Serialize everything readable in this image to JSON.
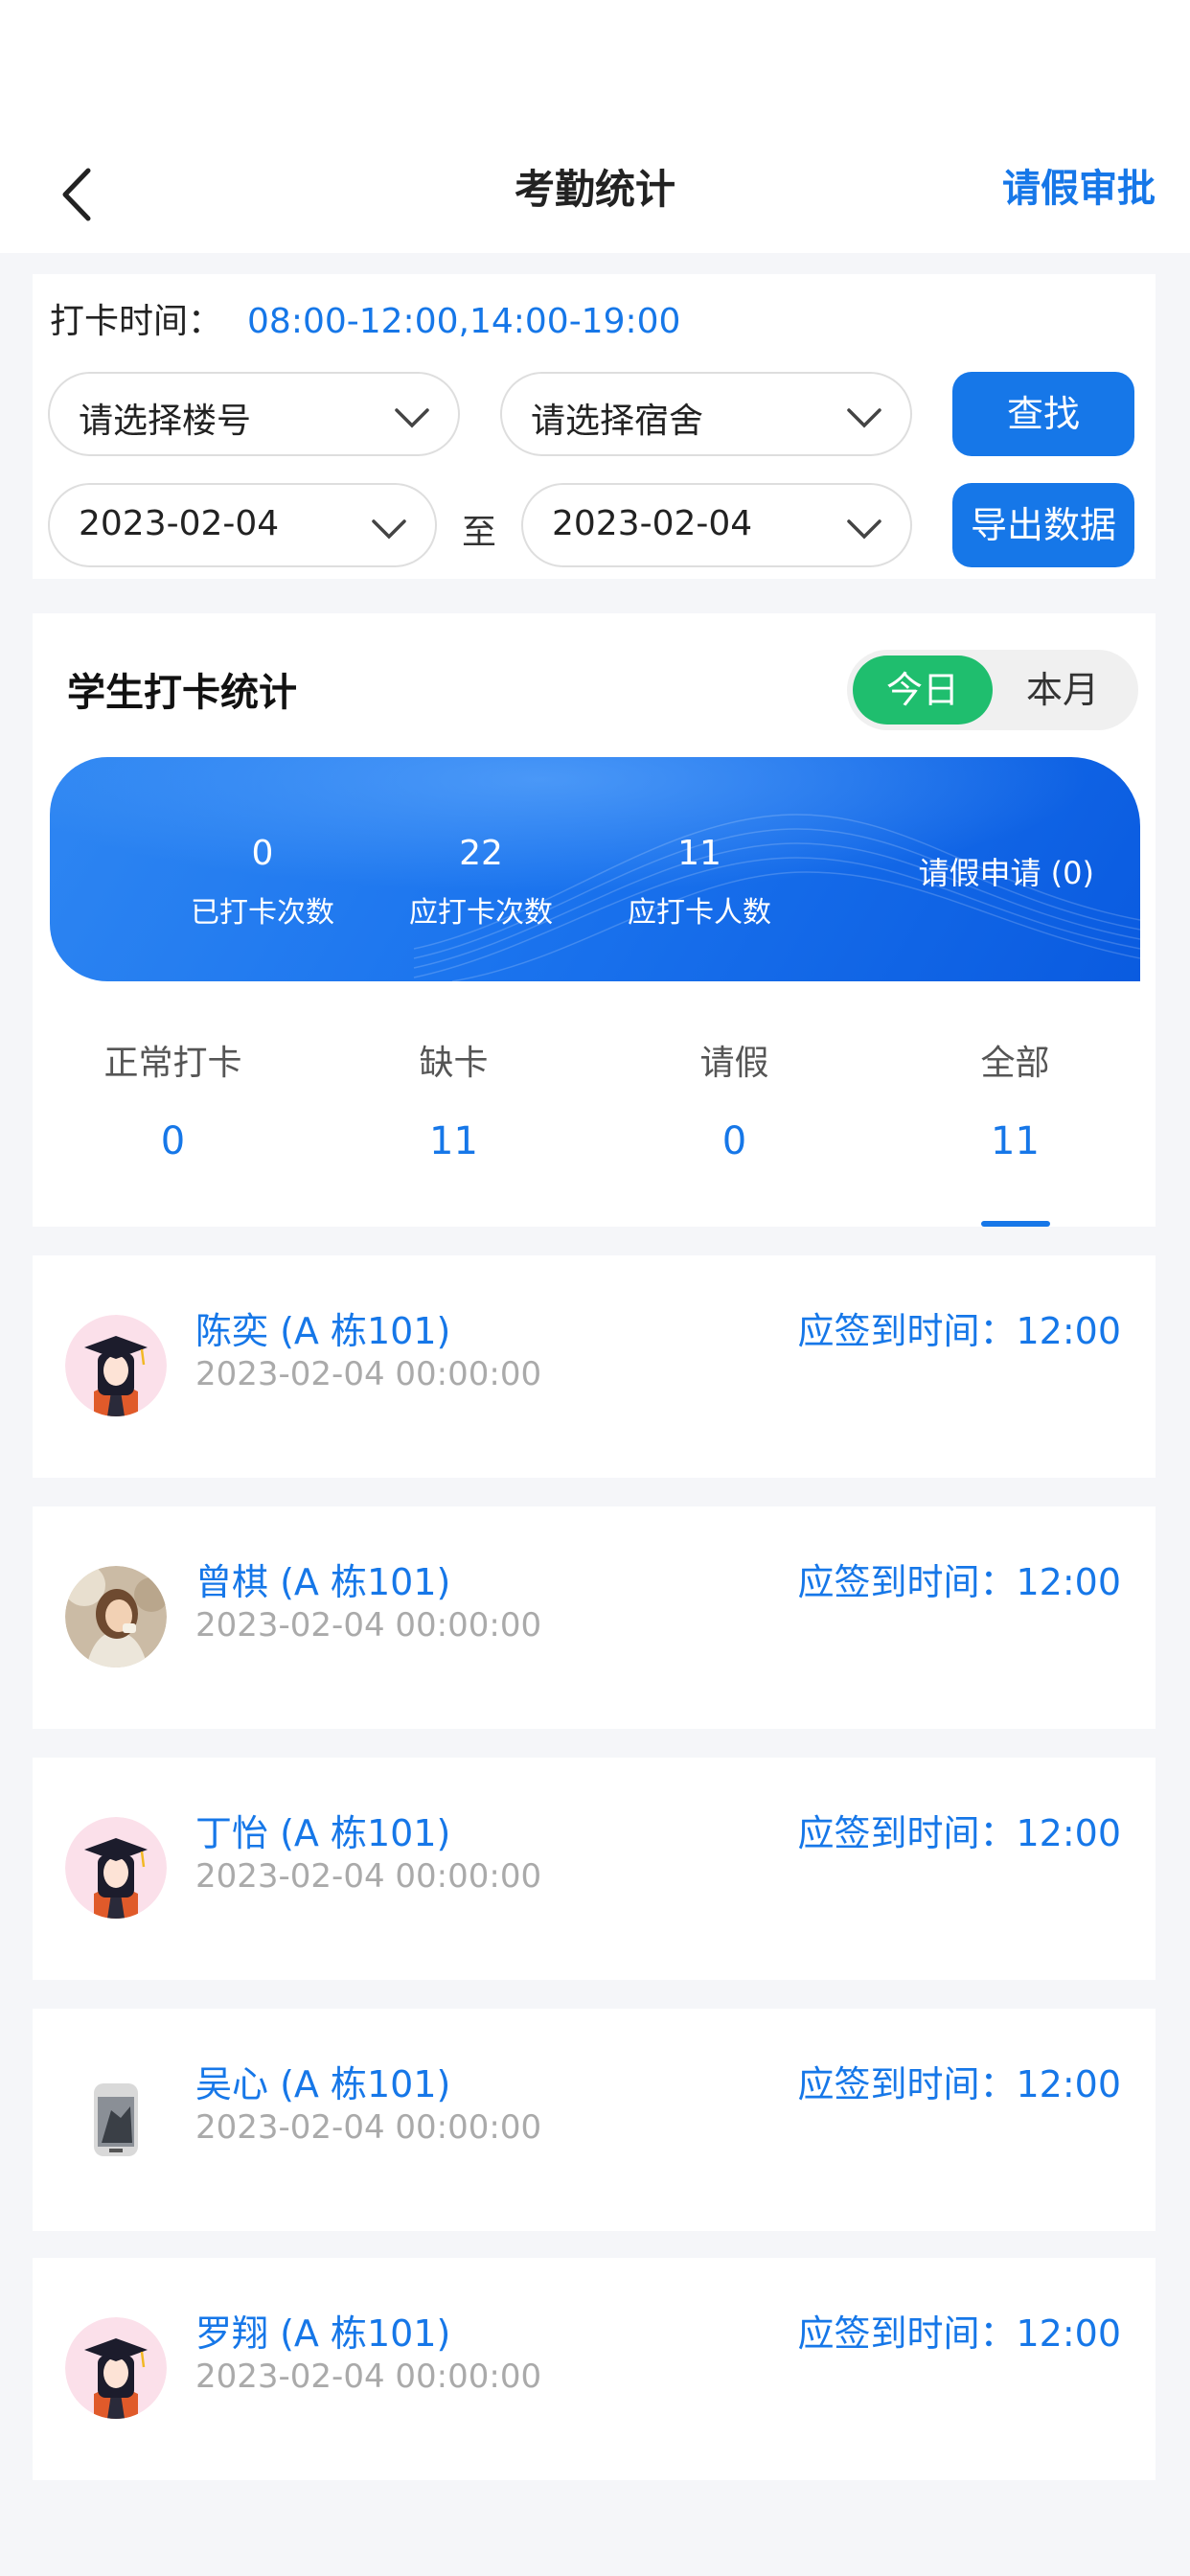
{
  "nav": {
    "title": "考勤统计",
    "right_action": "请假审批"
  },
  "filter": {
    "time_label": "打卡时间：",
    "time_value": "08:00-12:00,14:00-19:00",
    "building_placeholder": "请选择楼号",
    "dorm_placeholder": "请选择宿舍",
    "search_button": "查找",
    "start_date": "2023-02-04",
    "to_label": "至",
    "end_date": "2023-02-04",
    "export_button": "导出数据"
  },
  "stats": {
    "title": "学生打卡统计",
    "toggle": {
      "today": "今日",
      "month": "本月",
      "selected": "今日"
    },
    "banner": {
      "checked_count": "0",
      "checked_label": "已打卡次数",
      "should_count": "22",
      "should_label": "应打卡次数",
      "people_count": "11",
      "people_label": "应打卡人数",
      "leave_request": "请假申请 (0)"
    },
    "tabs": [
      {
        "label": "正常打卡",
        "count": "0"
      },
      {
        "label": "缺卡",
        "count": "11"
      },
      {
        "label": "请假",
        "count": "0"
      },
      {
        "label": "全部",
        "count": "11"
      }
    ],
    "active_tab": "全部"
  },
  "records": [
    {
      "name": "陈奕 (A 栋101)",
      "date": "2023-02-04 00:00:00",
      "due": "应签到时间：12:00",
      "avatar": "graduate-avatar"
    },
    {
      "name": "曾棋 (A 栋101)",
      "date": "2023-02-04 00:00:00",
      "due": "应签到时间：12:00",
      "avatar": "photo-avatar"
    },
    {
      "name": "丁怡 (A 栋101)",
      "date": "2023-02-04 00:00:00",
      "due": "应签到时间：12:00",
      "avatar": "graduate-avatar"
    },
    {
      "name": "吴心 (A 栋101)",
      "date": "2023-02-04 00:00:00",
      "due": "应签到时间：12:00",
      "avatar": "figure-avatar"
    },
    {
      "name": "罗翔 (A 栋101)",
      "date": "2023-02-04 00:00:00",
      "due": "应签到时间：12:00",
      "avatar": "graduate-avatar"
    }
  ],
  "colors": {
    "primary": "#1677e8",
    "toggle_active": "#1fbe6e",
    "background": "#f5f6f9"
  }
}
